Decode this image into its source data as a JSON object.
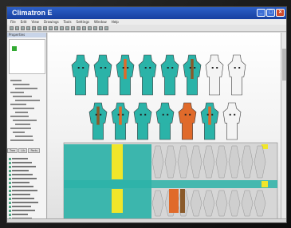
{
  "window": {
    "title": "Climatron E"
  },
  "menu": [
    "File",
    "Edit",
    "View",
    "Drawings",
    "Tools",
    "Settings",
    "Window",
    "Help"
  ],
  "colors": {
    "teal": "#2bb3a8",
    "orange": "#e06a2a",
    "yellow": "#f0e62a",
    "grey": "#9a9a9a",
    "brown": "#8a5a2a"
  },
  "panel": {
    "title": "Properties"
  },
  "tabs": [
    "Tree",
    "Lib",
    "Parts"
  ],
  "icons": [
    "minimize-icon",
    "maximize-icon",
    "close-icon"
  ]
}
